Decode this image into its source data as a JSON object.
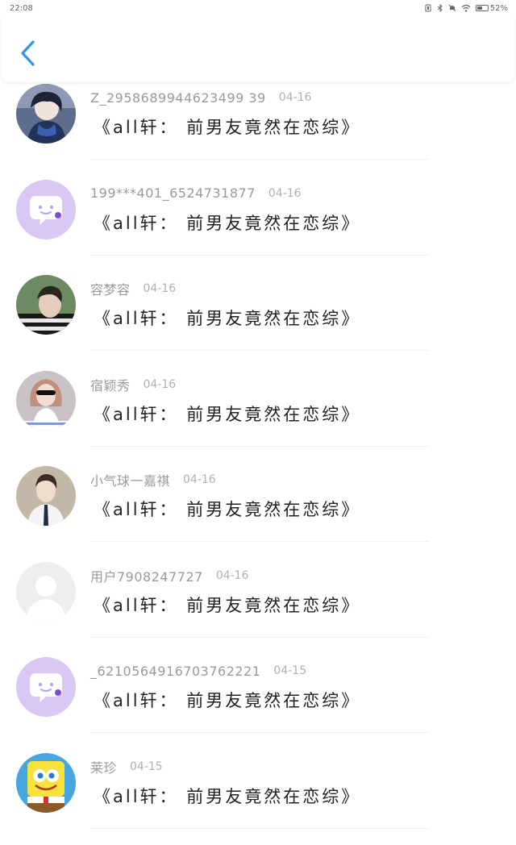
{
  "status_bar": {
    "time": "22:08",
    "battery_text": "52%",
    "battery_level": 0.52
  },
  "header": {
    "back_icon": "chevron-left-icon",
    "accent_color": "#2f96e8"
  },
  "comments": [
    {
      "username": "Z_2958689944623499 39",
      "date": "04-16",
      "title": "《all轩：  前男友竟然在恋综》",
      "avatar": "anime-character"
    },
    {
      "username": "199***401_6524731877",
      "date": "04-16",
      "title": "《all轩：  前男友竟然在恋综》",
      "avatar": "default-chat-bubble"
    },
    {
      "username": "容梦容",
      "date": "04-16",
      "title": "《all轩：  前男友竟然在恋综》",
      "avatar": "photo-boy"
    },
    {
      "username": "宿颖秀",
      "date": "04-16",
      "title": "《all轩：  前男友竟然在恋综》",
      "avatar": "photo-girl"
    },
    {
      "username": "小气球一嘉祺",
      "date": "04-16",
      "title": "《all轩：  前男友竟然在恋综》",
      "avatar": "photo-boy-suit"
    },
    {
      "username": "用户7908247727",
      "date": "04-16",
      "title": "《all轩：  前男友竟然在恋综》",
      "avatar": "default-silhouette"
    },
    {
      "username": "_6210564916703762221",
      "date": "04-15",
      "title": "《all轩：  前男友竟然在恋综》",
      "avatar": "default-chat-bubble"
    },
    {
      "username": "莱珍",
      "date": "04-15",
      "title": "《all轩：  前男友竟然在恋综》",
      "avatar": "cartoon-sponge"
    }
  ]
}
